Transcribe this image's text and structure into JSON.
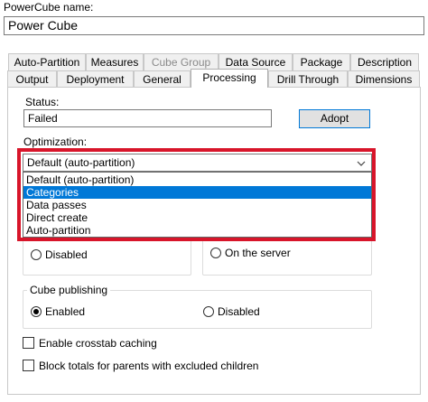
{
  "powercube": {
    "name_label": "PowerCube name:",
    "name_value": "Power Cube"
  },
  "tabs_row1": [
    {
      "label": "Auto-Partition",
      "disabled": false
    },
    {
      "label": "Measures",
      "disabled": false
    },
    {
      "label": "Cube Group",
      "disabled": true
    },
    {
      "label": "Data Source",
      "disabled": false
    },
    {
      "label": "Package",
      "disabled": false
    },
    {
      "label": "Description",
      "disabled": false
    }
  ],
  "tabs_row2": [
    {
      "label": "Output",
      "active": false
    },
    {
      "label": "Deployment",
      "active": false
    },
    {
      "label": "General",
      "active": false
    },
    {
      "label": "Processing",
      "active": true
    },
    {
      "label": "Drill Through",
      "active": false
    },
    {
      "label": "Dimensions",
      "active": false
    }
  ],
  "status": {
    "label": "Status:",
    "value": "Failed",
    "adopt_label": "Adopt"
  },
  "optimization": {
    "label": "Optimization:",
    "selected": "Default (auto-partition)",
    "options": [
      {
        "label": "Default (auto-partition)",
        "selected": false
      },
      {
        "label": "Categories",
        "selected": true
      },
      {
        "label": "Data passes",
        "selected": false
      },
      {
        "label": "Direct create",
        "selected": false
      },
      {
        "label": "Auto-partition",
        "selected": false
      }
    ]
  },
  "hidden_groups": {
    "left_radio_label": "Disabled",
    "right_radio_label": "On the server"
  },
  "cube_publishing": {
    "legend": "Cube publishing",
    "enabled_label": "Enabled",
    "disabled_label": "Disabled",
    "enabled_selected": true
  },
  "checkboxes": {
    "crosstab_label": "Enable crosstab caching",
    "block_totals_label": "Block totals for parents with excluded children"
  },
  "colors": {
    "highlight": "#d8152a",
    "selection": "#0078d7"
  }
}
